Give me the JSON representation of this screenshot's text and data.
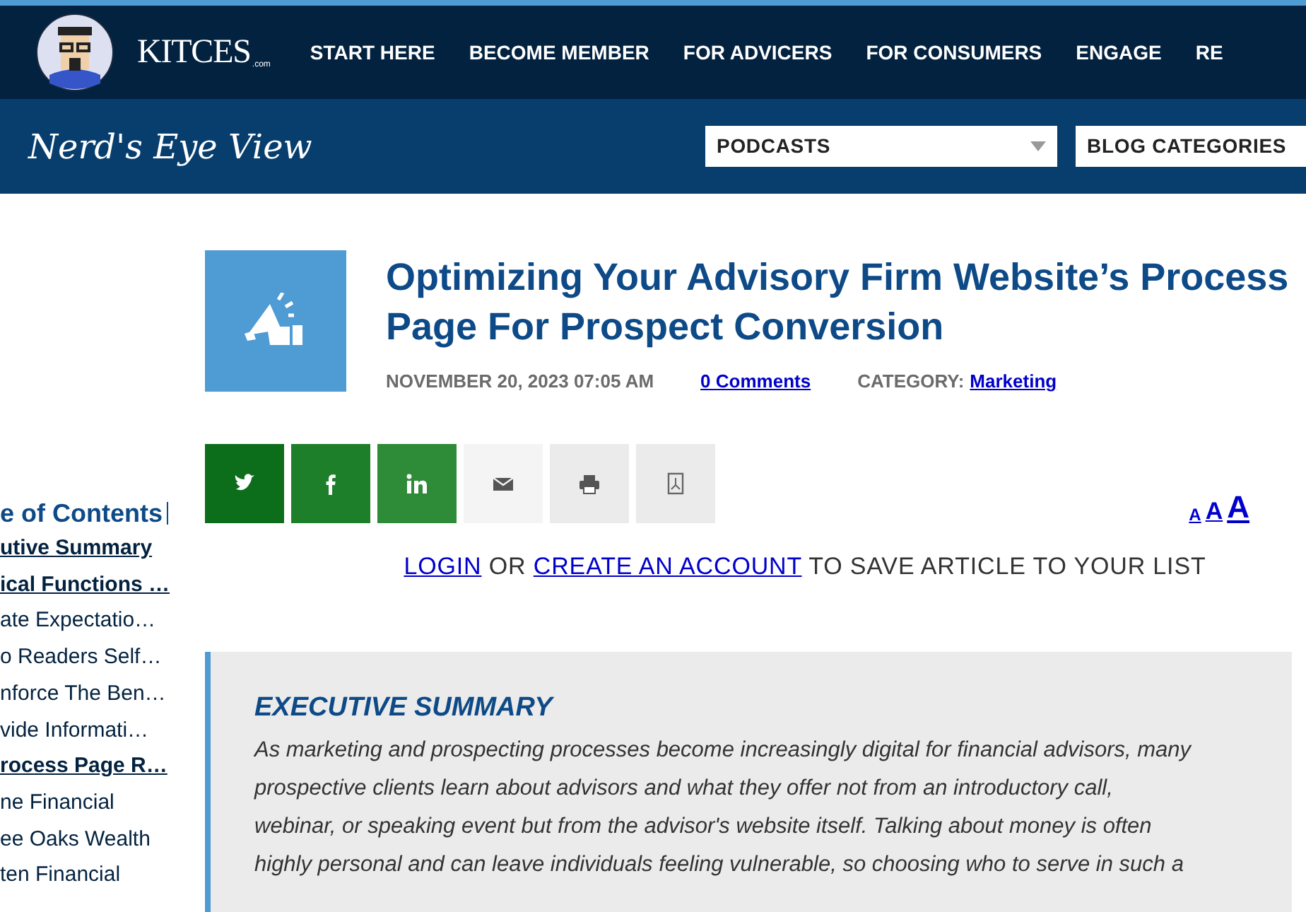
{
  "site": {
    "logo": "KITCES",
    "logo_suffix": ".com",
    "nav": [
      "START HERE",
      "BECOME MEMBER",
      "FOR ADVICERS",
      "FOR CONSUMERS",
      "ENGAGE",
      "RE"
    ]
  },
  "subheader": {
    "title": "Nerd's Eye View",
    "dropdowns": [
      {
        "label": "PODCASTS",
        "caret": true
      },
      {
        "label": "BLOG CATEGORIES",
        "caret": false
      }
    ]
  },
  "toc": {
    "title": "e of Contents",
    "items": [
      {
        "text": "utive Summary",
        "bold": true
      },
      {
        "text": "ical Functions …",
        "bold": true
      },
      {
        "text": "ate Expectatio…",
        "bold": false
      },
      {
        "text": "o Readers Self…",
        "bold": false
      },
      {
        "text": "nforce The Ben…",
        "bold": false
      },
      {
        "text": "vide Informati…",
        "bold": false
      },
      {
        "text": "rocess Page R…",
        "bold": true
      },
      {
        "text": "ne Financial",
        "bold": false
      },
      {
        "text": "ee Oaks Wealth",
        "bold": false
      },
      {
        "text": "ten Financial",
        "bold": false
      }
    ]
  },
  "article": {
    "title": "Optimizing Your Advisory Firm Website’s Process Page For Prospect Conversion",
    "date": "NOVEMBER 20, 2023 07:05 AM",
    "comments": "0 Comments",
    "category_label": "CATEGORY:",
    "category": "Marketing",
    "share": [
      {
        "kind": "twitter"
      },
      {
        "kind": "facebook"
      },
      {
        "kind": "linkedin"
      },
      {
        "kind": "email"
      },
      {
        "kind": "print"
      },
      {
        "kind": "pdf"
      }
    ],
    "font_sizes": [
      "A",
      "A",
      "A"
    ],
    "save": {
      "login": "LOGIN",
      "or": "OR",
      "create": "CREATE AN ACCOUNT",
      "rest": "TO SAVE ARTICLE TO YOUR LIST"
    },
    "summary": {
      "heading": "EXECUTIVE SUMMARY",
      "lines": [
        "As marketing and prospecting processes become increasingly digital for financial advisors, many",
        "prospective clients learn about advisors and what they offer not from an introductory call,",
        "webinar, or speaking event but from the advisor's website itself. Talking about money is often",
        "highly personal and can leave individuals feeling vulnerable, so choosing who to serve in such a"
      ]
    }
  }
}
